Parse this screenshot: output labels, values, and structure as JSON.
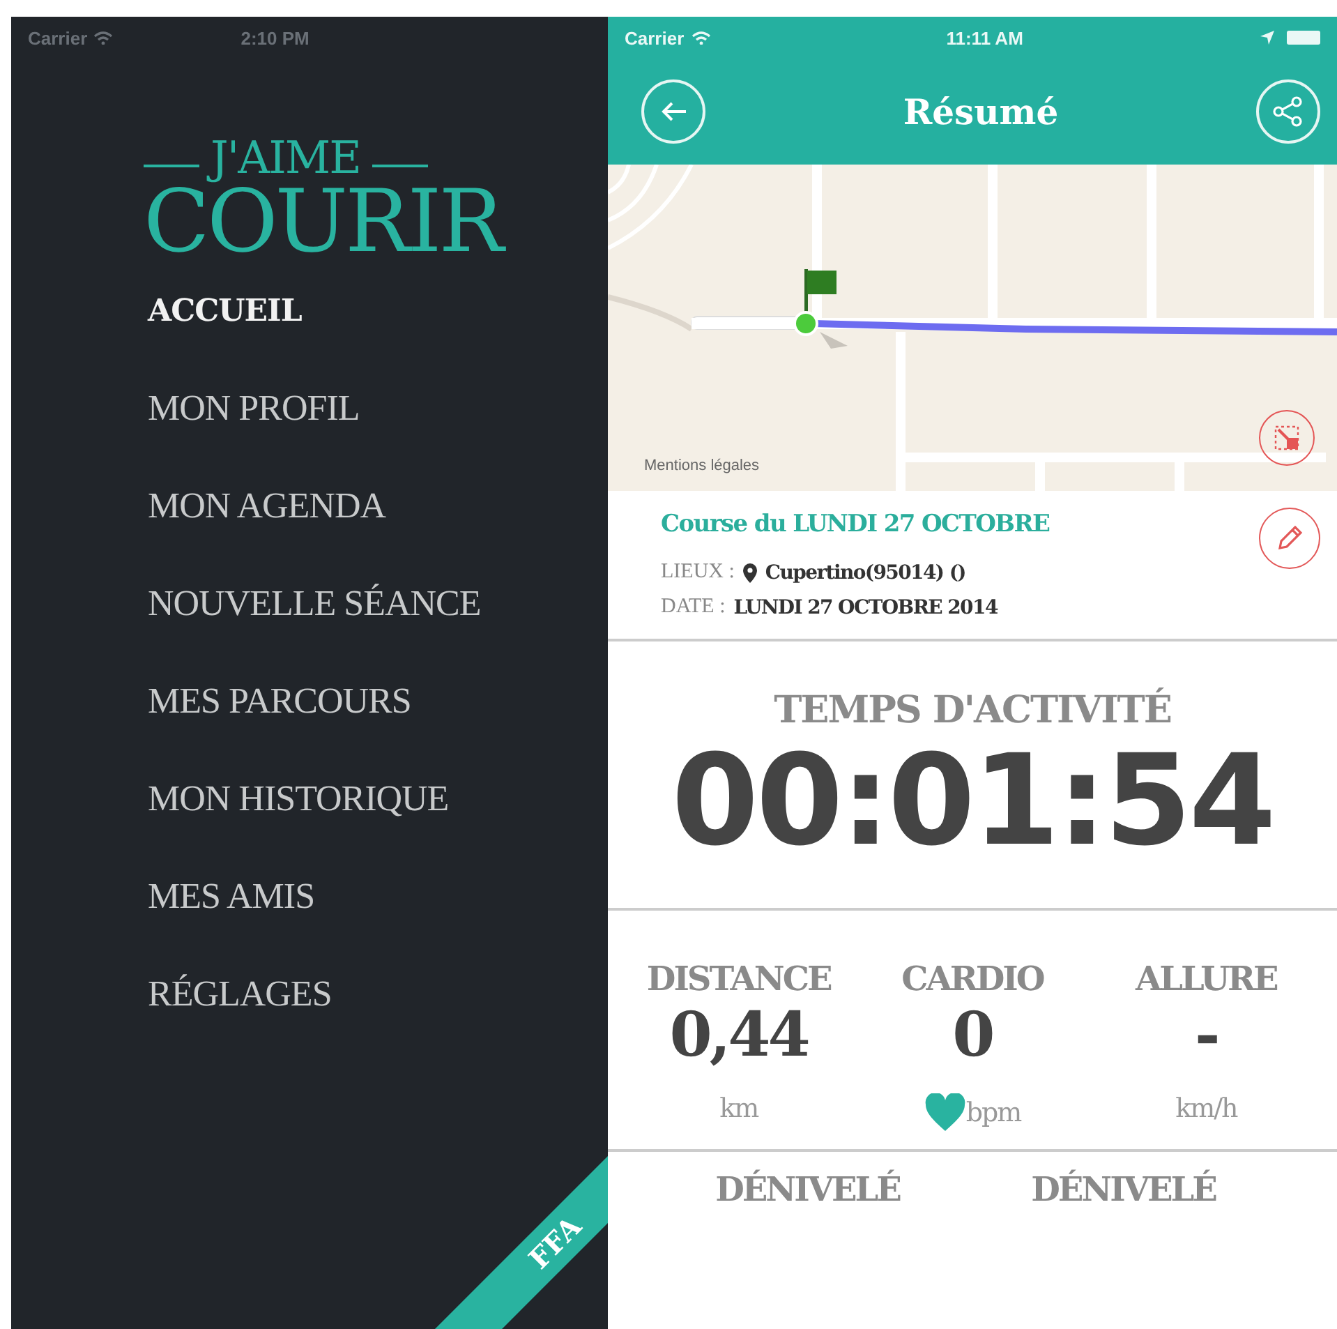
{
  "menu_screen": {
    "status_bar": {
      "carrier": "Carrier",
      "time": "2:10 PM"
    },
    "logo": {
      "top": "J'AIME",
      "bottom": "COURIR"
    },
    "menu": [
      {
        "label": "ACCUEIL",
        "selected": true
      },
      {
        "label": "MON PROFIL",
        "selected": false
      },
      {
        "label": "MON AGENDA",
        "selected": false
      },
      {
        "label": "NOUVELLE SÉANCE",
        "selected": false
      },
      {
        "label": "MES PARCOURS",
        "selected": false
      },
      {
        "label": "MON HISTORIQUE",
        "selected": false
      },
      {
        "label": "MES AMIS",
        "selected": false
      },
      {
        "label": "RÉGLAGES",
        "selected": false
      }
    ],
    "ribbon": "FFA"
  },
  "summary_screen": {
    "status_bar": {
      "carrier": "Carrier",
      "time": "11:11 AM"
    },
    "nav": {
      "title": "Résumé"
    },
    "map": {
      "legal_link": "Mentions légales"
    },
    "session": {
      "title": "Course du LUNDI 27 OCTOBRE",
      "fields": [
        {
          "kind": "place",
          "label": "LIEUX :",
          "value": "Cupertino(95014) ()"
        },
        {
          "kind": "plain",
          "label": "DATE :",
          "value": "LUNDI 27 OCTOBRE 2014"
        }
      ]
    },
    "activity": {
      "label": "TEMPS D'ACTIVITÉ",
      "value": "00:01:54"
    },
    "stats": [
      {
        "kind": "plain",
        "label": "DISTANCE",
        "value": "0,44",
        "unit": "km"
      },
      {
        "kind": "heart",
        "label": "CARDIO",
        "value": "0",
        "unit": "bpm"
      },
      {
        "kind": "plain",
        "label": "ALLURE",
        "value": "-",
        "unit": "km/h"
      }
    ],
    "elevation": [
      {
        "label": "DÉNIVELÉ"
      },
      {
        "label": "DÉNIVELÉ"
      }
    ]
  }
}
